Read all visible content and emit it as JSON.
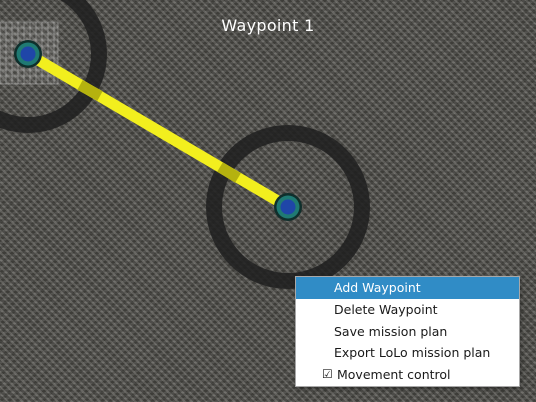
{
  "header": {
    "title": "Waypoint  1"
  },
  "context_menu": {
    "items": [
      {
        "label": "Add Waypoint",
        "highlighted": true
      },
      {
        "label": "Delete Waypoint"
      },
      {
        "label": "Save mission plan"
      },
      {
        "label": "Export LoLo mission plan"
      },
      {
        "label": "Movement control",
        "checked": true,
        "check_glyph": "☑"
      }
    ]
  },
  "colors": {
    "path": "#f2ef1e",
    "waypoint_fill": "#1f46a8",
    "waypoint_ring": "#1f7a73",
    "radius_ring": "#1e1e1e",
    "menu_highlight": "#308cc6"
  },
  "icons": {
    "waypoint": "waypoint-marker-icon",
    "check": "checkbox-checked-icon"
  }
}
